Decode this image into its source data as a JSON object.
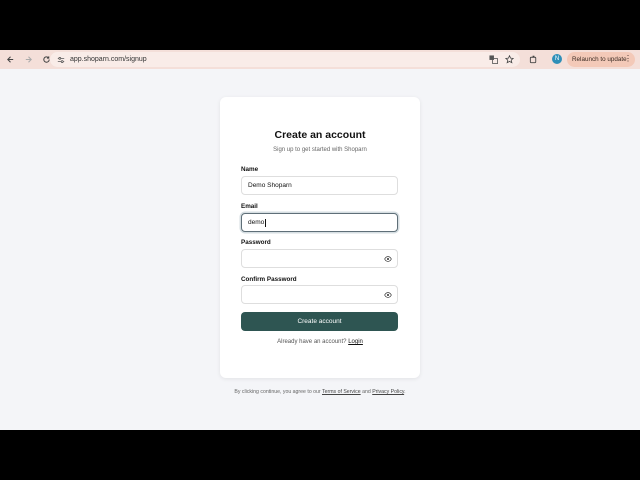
{
  "browser": {
    "url": "app.shoparn.com/signup",
    "profile_initial": "N",
    "relaunch_label": "Relaunch to update",
    "menu_glyph": "⋮"
  },
  "signup": {
    "title": "Create an account",
    "subtitle": "Sign up to get started with Shoparn",
    "name_label": "Name",
    "name_value": "Demo Shoparn",
    "email_label": "Email",
    "email_value": "demo",
    "password_label": "Password",
    "password_value": "",
    "confirm_label": "Confirm Password",
    "confirm_value": "",
    "submit_label": "Create account",
    "login_prompt": "Already have an account?",
    "login_link": "Login"
  },
  "terms": {
    "prefix": "By clicking continue, you agree to our",
    "tos": "Terms of Service",
    "and": "and",
    "privacy": "Privacy Policy",
    "suffix": "."
  },
  "colors": {
    "toolbar": "#f4dfd9",
    "primary_button": "#2e5552",
    "page_bg": "#f4f5f8"
  }
}
